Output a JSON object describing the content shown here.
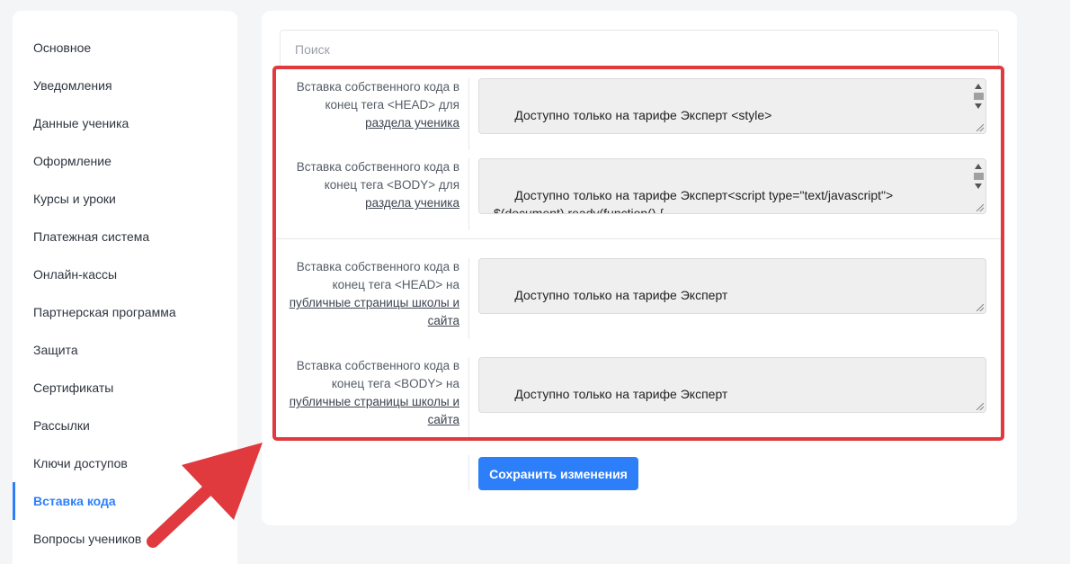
{
  "sidebar": {
    "items": [
      {
        "label": "Основное"
      },
      {
        "label": "Уведомления"
      },
      {
        "label": "Данные ученика"
      },
      {
        "label": "Оформление"
      },
      {
        "label": "Курсы и уроки"
      },
      {
        "label": "Платежная система"
      },
      {
        "label": "Онлайн-кассы"
      },
      {
        "label": "Партнерская программа"
      },
      {
        "label": "Защита"
      },
      {
        "label": "Сертификаты"
      },
      {
        "label": "Рассылки"
      },
      {
        "label": "Ключи доступов"
      },
      {
        "label": "Вставка кода",
        "active": true
      },
      {
        "label": "Вопросы учеников"
      }
    ]
  },
  "search": {
    "placeholder": "Поиск"
  },
  "fields": [
    {
      "label_text": "Вставка собственного кода в конец тега <HEAD> для",
      "label_link": "раздела ученика",
      "value": "Доступно только на тарифе Эксперт <style>\n\n        * {"
    },
    {
      "label_text": "Вставка собственного кода в конец тега <BODY> для",
      "label_link": "раздела ученика",
      "value": "Доступно только на тарифе Эксперт<script type=\"text/javascript\">\n$(document).ready(function() {\n    $('div[data-tooltip=\"В модуле есть задания\"] span').html('Есть Домашние"
    },
    {
      "label_text": "Вставка собственного кода в конец тега <HEAD> на",
      "label_link": "публичные страницы школы и сайта",
      "value": "Доступно только на тарифе Эксперт"
    },
    {
      "label_text": "Вставка собственного кода в конец тега <BODY> на",
      "label_link": "публичные страницы школы и сайта",
      "value": "Доступно только на тарифе Эксперт"
    }
  ],
  "save_button": {
    "label": "Сохранить изменения"
  },
  "colors": {
    "accent": "#2d7ff9",
    "annotation": "#e0393e"
  }
}
